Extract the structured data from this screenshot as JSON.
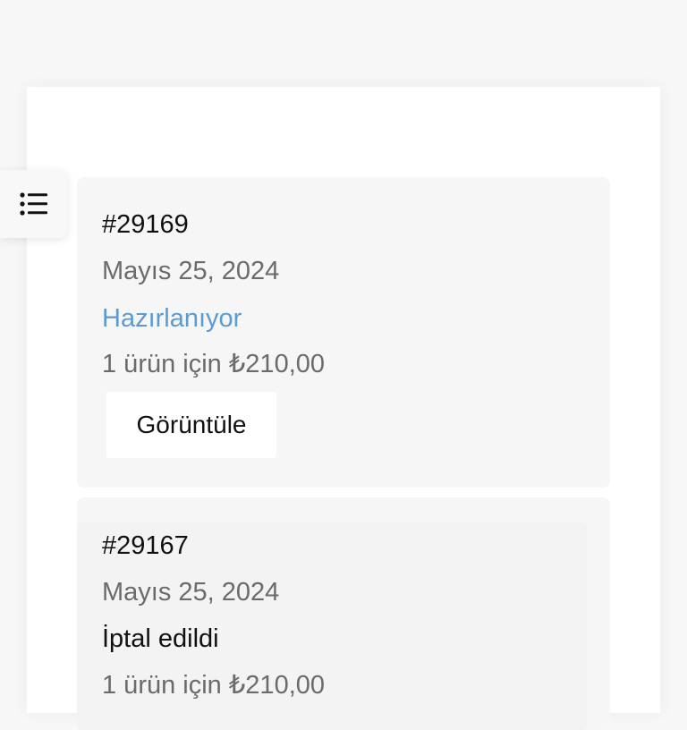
{
  "toc": {
    "icon": "list-icon"
  },
  "orders": [
    {
      "number": "#29169",
      "date": "Mayıs 25, 2024",
      "status": "Hazırlanıyor",
      "status_color": "#5b9bd2",
      "summary": "1 ürün için ₺210,00",
      "action_label": "Görüntüle"
    },
    {
      "number": "#29167",
      "date": "Mayıs 25, 2024",
      "status": "İptal edildi",
      "status_color": "#111111",
      "summary": "1 ürün için ₺210,00"
    }
  ]
}
